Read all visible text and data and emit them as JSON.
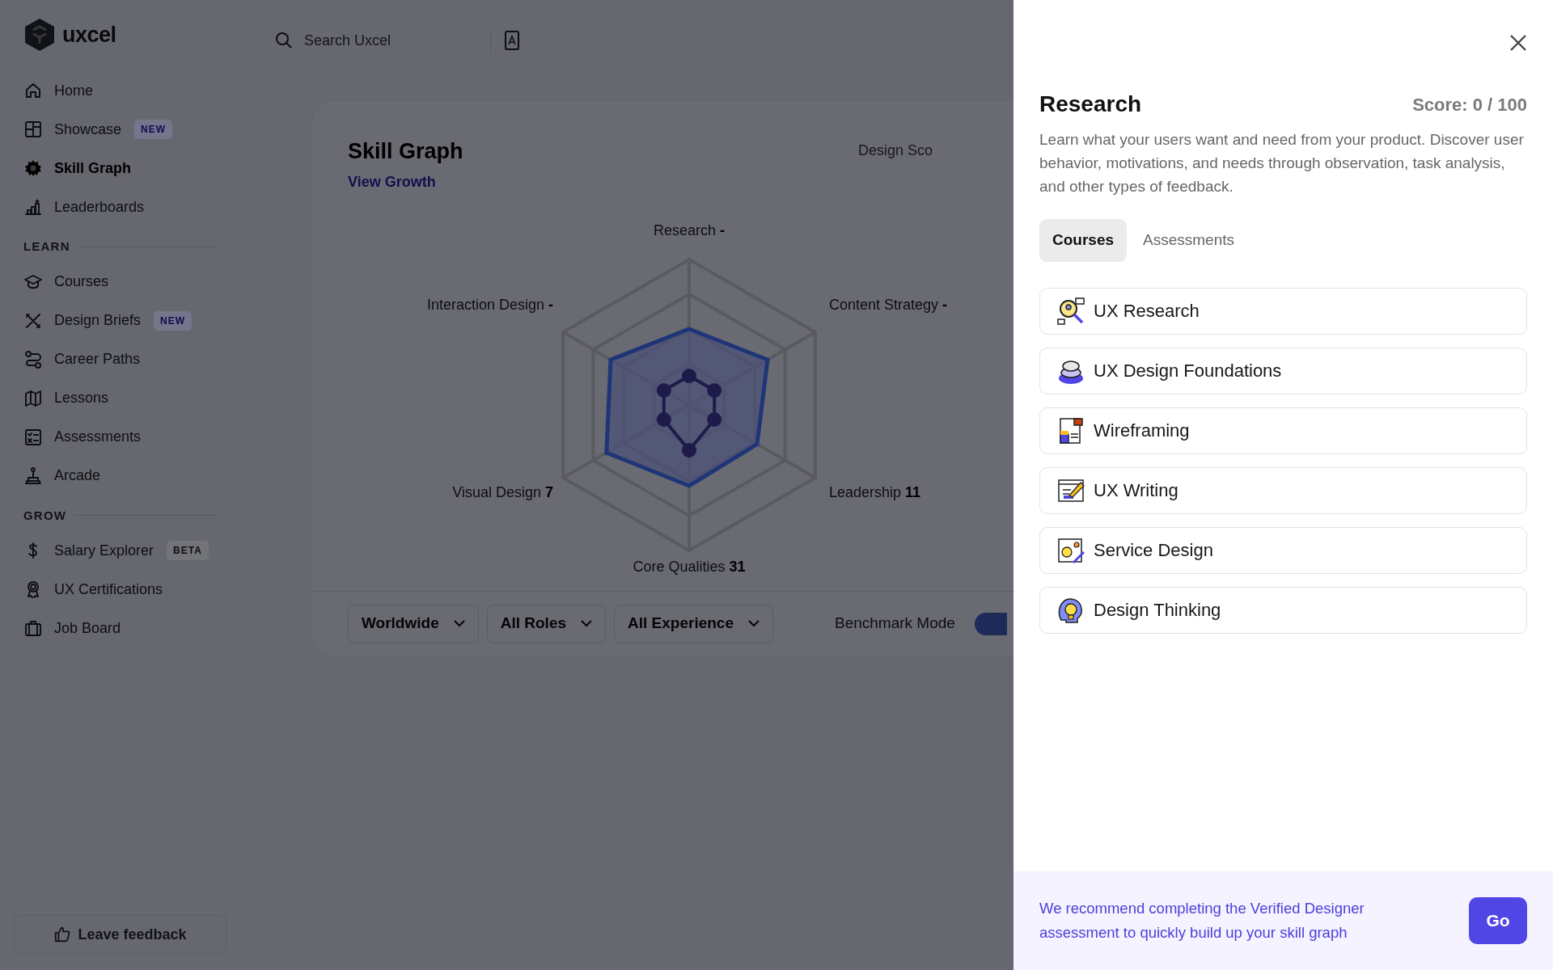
{
  "brand": {
    "name": "uxcel"
  },
  "sidebar": {
    "sections": [
      {
        "items": [
          {
            "label": "Home",
            "selected": false
          },
          {
            "label": "Showcase",
            "badge": "NEW",
            "selected": false
          },
          {
            "label": "Skill Graph",
            "selected": true
          },
          {
            "label": "Leaderboards",
            "selected": false
          }
        ]
      },
      {
        "heading": "LEARN",
        "items": [
          {
            "label": "Courses",
            "selected": false
          },
          {
            "label": "Design Briefs",
            "badge": "NEW",
            "selected": false
          },
          {
            "label": "Career Paths",
            "selected": false
          },
          {
            "label": "Lessons",
            "selected": false
          },
          {
            "label": "Assessments",
            "selected": false
          },
          {
            "label": "Arcade",
            "selected": false
          }
        ]
      },
      {
        "heading": "GROW",
        "items": [
          {
            "label": "Salary Explorer",
            "badge": "BETA",
            "selected": false
          },
          {
            "label": "UX Certifications",
            "selected": false
          },
          {
            "label": "Job Board",
            "selected": false
          }
        ]
      }
    ],
    "feedback_button": "Leave feedback"
  },
  "search": {
    "placeholder": "Search Uxcel"
  },
  "skill_graph": {
    "title": "Skill Graph",
    "link": "View Growth",
    "design_score": "Design Sco",
    "axes": [
      {
        "name": "Research",
        "value": "-"
      },
      {
        "name": "Interaction Design",
        "value": "-"
      },
      {
        "name": "Content Strategy",
        "value": "-"
      },
      {
        "name": "Visual Design",
        "value": "7"
      },
      {
        "name": "Leadership",
        "value": "11"
      },
      {
        "name": "Core Qualities",
        "value": "31"
      }
    ],
    "filters": [
      "Worldwide",
      "All Roles",
      "All Experience"
    ],
    "benchmark": {
      "label": "Benchmark Mode",
      "on": true
    }
  },
  "panel": {
    "title": "Research",
    "score": "Score: 0 / 100",
    "description": "Learn what your users want and need from your product. Discover user behavior, motivations, and needs through observation, task analysis, and other types of feedback.",
    "tabs": [
      {
        "label": "Courses",
        "selected": true
      },
      {
        "label": "Assessments",
        "selected": false
      }
    ],
    "courses": [
      "UX Research",
      "UX Design Foundations",
      "Wireframing",
      "UX Writing",
      "Service Design",
      "Design Thinking"
    ],
    "recommendation": "We recommend completing the Verified Designer assessment to quickly build up your skill graph",
    "go_button": "Go"
  }
}
